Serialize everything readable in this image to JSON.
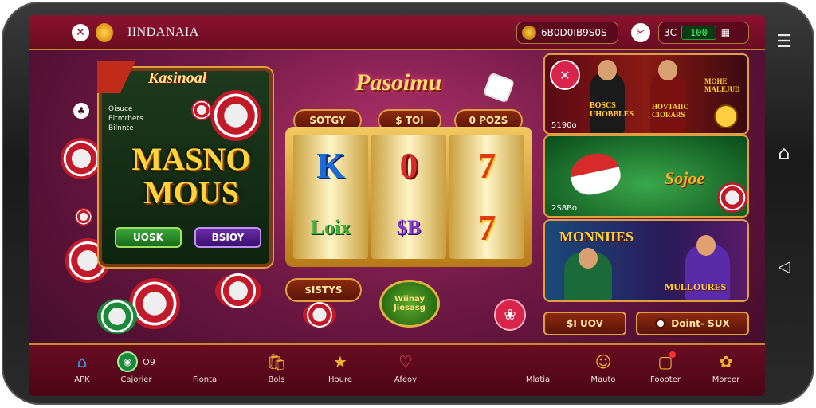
{
  "header": {
    "brand": "IINDANAIA",
    "account_text": "6B0D0IB9S0S",
    "balance_prefix": "3C",
    "balance_value": "100"
  },
  "promo": {
    "tag": "Kasinoal",
    "sub_lines": "Oisuce\nEltmrbets\nBilnnte",
    "big_text": "MASNO MOUS",
    "btn_left": "UOSK",
    "btn_right": "BSIOY"
  },
  "center": {
    "title": "Pasoimu",
    "chips": [
      "SOTGY",
      "$ TOI",
      "0 POZS"
    ],
    "under_button": "$ISTYS",
    "medal_text": "Wiinay Jiesasg"
  },
  "slot": {
    "reels": [
      [
        "K",
        "Loix"
      ],
      [
        "0",
        "$B"
      ],
      [
        "7",
        "7"
      ]
    ]
  },
  "cards": [
    {
      "corner_label": "5190o",
      "text": "BOSCS UHOBBLES",
      "text2": "HOVTAIIC CIORARS",
      "text3": "MOHE MALEJUD"
    },
    {
      "corner_label": "2S8Bo",
      "text": "Sojoe"
    },
    {
      "corner_label": "",
      "text": "MONNIIES",
      "text2": "MULLOURES"
    }
  ],
  "right_buttons": {
    "left": "$I UOV",
    "right": "Doint-   SUX"
  },
  "bottom_nav": [
    {
      "label": "APK",
      "icon": "home-icon"
    },
    {
      "label": "Cajorier",
      "icon": "chip-icon",
      "badge": "O9"
    },
    {
      "label": "Fionta",
      "icon": "blank"
    },
    {
      "label": "Bols",
      "icon": "bag-icon"
    },
    {
      "label": "Houre",
      "icon": "star-icon"
    },
    {
      "label": "Afeoy",
      "icon": "heart-icon"
    },
    {
      "label": "Mlatia",
      "icon": "blank"
    },
    {
      "label": "Mauto",
      "icon": "smile-icon"
    },
    {
      "label": "Foooter",
      "icon": "message-icon"
    },
    {
      "label": "Morcer",
      "icon": "flower-icon"
    }
  ],
  "colors": {
    "accent": "#e0a040",
    "header": "#8c1230",
    "balance": "#3dff6a"
  }
}
